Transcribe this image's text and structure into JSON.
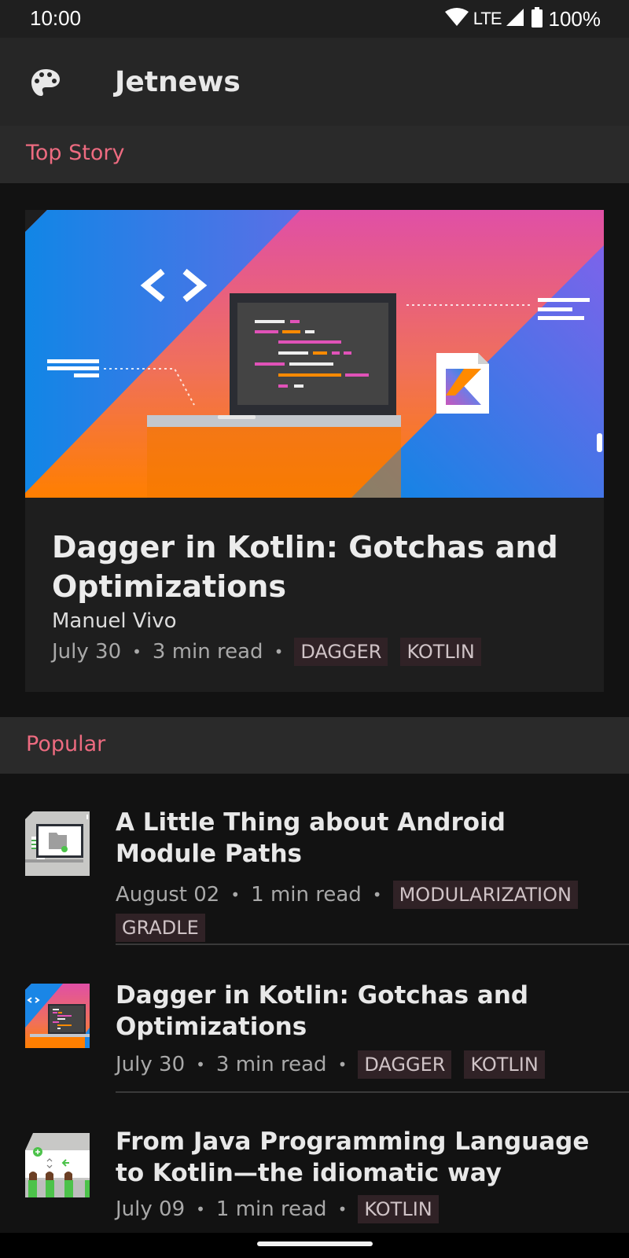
{
  "status_bar": {
    "time": "10:00",
    "network": "LTE",
    "battery": "100%",
    "icons": [
      "wifi-icon",
      "cell-signal-icon",
      "battery-icon"
    ]
  },
  "app_bar": {
    "title": "Jetnews",
    "icon": "palette-icon"
  },
  "top_story": {
    "section_label": "Top Story",
    "title": "Dagger in Kotlin: Gotchas and Optimizations",
    "author": "Manuel Vivo",
    "date": "July 30",
    "read_time": "3 min read",
    "separator": "•",
    "tags": [
      "DAGGER",
      "KOTLIN"
    ]
  },
  "popular": {
    "section_label": "Popular",
    "items": [
      {
        "title": "A Little Thing about Android Module Paths",
        "date": "August 02",
        "read_time": "1 min read",
        "tags": [
          "MODULARIZATION",
          "GRADLE"
        ]
      },
      {
        "title": "Dagger in Kotlin: Gotchas and Optimizations",
        "date": "July 30",
        "read_time": "3 min read",
        "tags": [
          "DAGGER",
          "KOTLIN"
        ]
      },
      {
        "title": "From Java Programming Language to Kotlin—the idiomatic way",
        "date": "July 09",
        "read_time": "1 min read",
        "tags": [
          "KOTLIN"
        ]
      }
    ]
  },
  "colors": {
    "accent": "#ed6b80",
    "background": "#121212",
    "surface": "#1e1e1e",
    "app_bar": "#262626",
    "tag_background": "#302226"
  }
}
